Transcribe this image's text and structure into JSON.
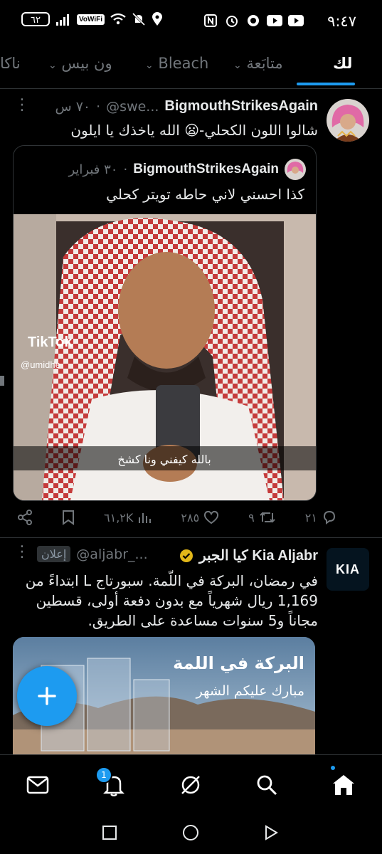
{
  "status": {
    "time": "٩:٤٧",
    "battery": "٦٢",
    "volte": "VoWiFi"
  },
  "tabs": [
    {
      "label": "لك",
      "active": true
    },
    {
      "label": "متابَعة"
    },
    {
      "label": "Bleach"
    },
    {
      "label": "ون بيس"
    },
    {
      "label": "ناكا"
    }
  ],
  "tweet1": {
    "name": "BigmouthStrikesAgain",
    "handle": "@swe...",
    "time": "٧٠ س",
    "text": "شالوا اللون الكحلي-😦 الله ياخذك يا ايلون",
    "quote": {
      "name": "BigmouthStrikesAgain",
      "date": "٣٠ فبراير",
      "text": "كذا احسني لاني حاطه تويتر كحلي",
      "media": {
        "watermark": "TikTok",
        "watermark_user": "@umidhe",
        "caption": "بالله كيفني ونا كشخ"
      }
    },
    "actions": {
      "replies": "٢١",
      "retweets": "٩",
      "likes": "٢٨٥",
      "views": "٦١,٢K"
    }
  },
  "tweet2": {
    "name": "كيا الجبر Kia Aljabr",
    "handle": "@aljabr_...",
    "ad_label": "إعلان",
    "logo_text": "KIA",
    "text": "في رمضان، البركة في اللّمة. سبورتاج L ابتداءً من 1,169 ريال شهرياً مع بدون دفعة أولى، قسطين مجاناً و5 سنوات مساعدة على الطريق.",
    "media": {
      "headline": "البركة في اللمة",
      "subline": "مبارك عليكم الشهر"
    }
  },
  "nav": {
    "badge": "1"
  },
  "colors": {
    "accent": "#1d9bf0",
    "background": "#000000",
    "muted": "#71767b",
    "verified": "#e2b719"
  }
}
